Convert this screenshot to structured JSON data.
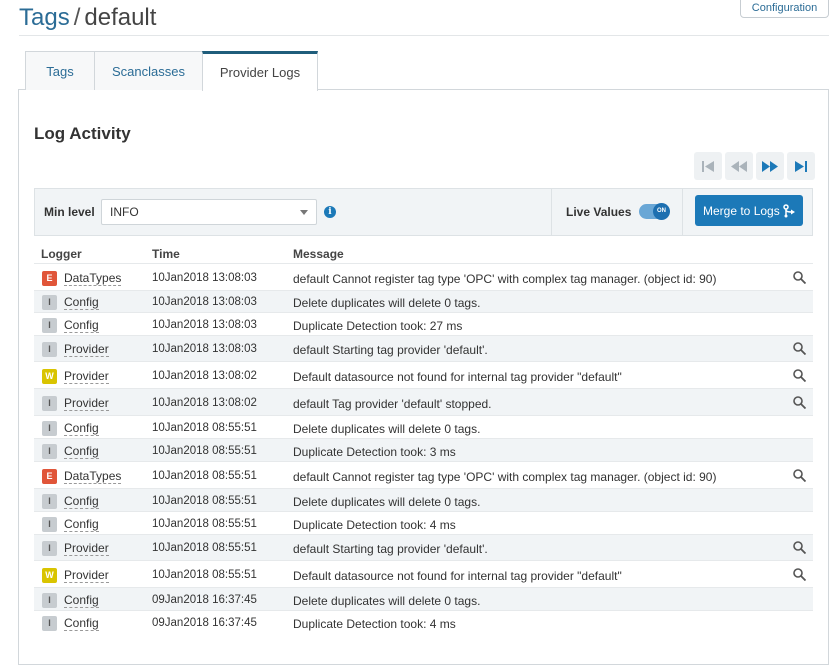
{
  "header": {
    "breadcrumb_root": "Tags",
    "breadcrumb_sep": "/",
    "breadcrumb_current": "default",
    "config_button": "Configuration"
  },
  "tabs": [
    {
      "label": "Tags",
      "active": false
    },
    {
      "label": "Scanclasses",
      "active": false
    },
    {
      "label": "Provider Logs",
      "active": true
    }
  ],
  "section": {
    "title": "Log Activity"
  },
  "pager": {
    "icons": [
      "first-page-icon",
      "rewind-icon",
      "fast-forward-icon",
      "last-page-icon"
    ]
  },
  "filter": {
    "min_level_label": "Min level",
    "min_level_value": "INFO",
    "live_values_label": "Live Values",
    "live_toggle_text": "ON",
    "live_values_on": true,
    "merge_button": "Merge to Logs"
  },
  "table": {
    "columns": [
      "Logger",
      "Time",
      "Message"
    ],
    "rows": [
      {
        "level": "E",
        "logger": "DataTypes",
        "time": "10Jan2018 13:08:03",
        "message": "default Cannot register tag type 'OPC' with complex tag manager. (object id: 90)",
        "details": true
      },
      {
        "level": "I",
        "logger": "Config",
        "time": "10Jan2018 13:08:03",
        "message": "Delete duplicates will delete 0 tags.",
        "details": false
      },
      {
        "level": "I",
        "logger": "Config",
        "time": "10Jan2018 13:08:03",
        "message": "Duplicate Detection took: 27 ms",
        "details": false
      },
      {
        "level": "I",
        "logger": "Provider",
        "time": "10Jan2018 13:08:03",
        "message": "default Starting tag provider 'default'.",
        "details": true
      },
      {
        "level": "W",
        "logger": "Provider",
        "time": "10Jan2018 13:08:02",
        "message": "Default datasource not found for internal tag provider \"default\"",
        "details": true
      },
      {
        "level": "I",
        "logger": "Provider",
        "time": "10Jan2018 13:08:02",
        "message": "default Tag provider 'default' stopped.",
        "details": true
      },
      {
        "level": "I",
        "logger": "Config",
        "time": "10Jan2018 08:55:51",
        "message": "Delete duplicates will delete 0 tags.",
        "details": false
      },
      {
        "level": "I",
        "logger": "Config",
        "time": "10Jan2018 08:55:51",
        "message": "Duplicate Detection took: 3 ms",
        "details": false
      },
      {
        "level": "E",
        "logger": "DataTypes",
        "time": "10Jan2018 08:55:51",
        "message": "default Cannot register tag type 'OPC' with complex tag manager. (object id: 90)",
        "details": true
      },
      {
        "level": "I",
        "logger": "Config",
        "time": "10Jan2018 08:55:51",
        "message": "Delete duplicates will delete 0 tags.",
        "details": false
      },
      {
        "level": "I",
        "logger": "Config",
        "time": "10Jan2018 08:55:51",
        "message": "Duplicate Detection took: 4 ms",
        "details": false
      },
      {
        "level": "I",
        "logger": "Provider",
        "time": "10Jan2018 08:55:51",
        "message": "default Starting tag provider 'default'.",
        "details": true
      },
      {
        "level": "W",
        "logger": "Provider",
        "time": "10Jan2018 08:55:51",
        "message": "Default datasource not found for internal tag provider \"default\"",
        "details": true
      },
      {
        "level": "I",
        "logger": "Config",
        "time": "09Jan2018 16:37:45",
        "message": "Delete duplicates will delete 0 tags.",
        "details": false
      },
      {
        "level": "I",
        "logger": "Config",
        "time": "09Jan2018 16:37:45",
        "message": "Duplicate Detection took: 4 ms",
        "details": false
      }
    ]
  },
  "colors": {
    "accent": "#1c79b8",
    "link": "#2b6c96",
    "error": "#e05539",
    "warning": "#d9c400",
    "info": "#c7ccd0"
  }
}
